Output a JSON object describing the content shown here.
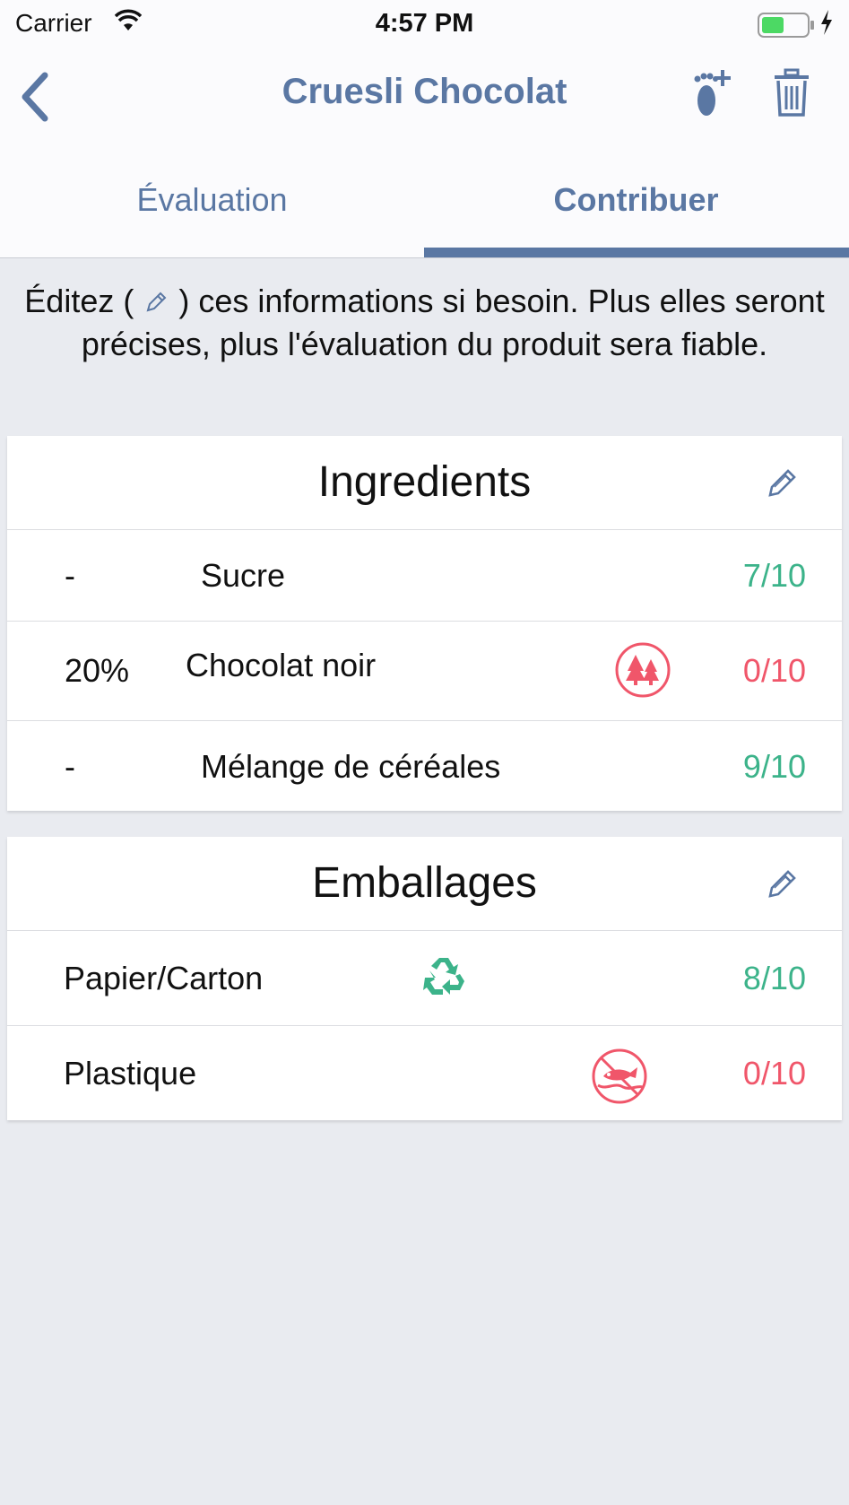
{
  "status_bar": {
    "carrier": "Carrier",
    "time": "4:57 PM"
  },
  "nav": {
    "title": "Cruesli Chocolat",
    "back_icon": "chevron-left-icon",
    "add_footprint_icon": "footprint-add-icon",
    "delete_icon": "trash-icon"
  },
  "tabs": [
    {
      "label": "Évaluation",
      "selected": false
    },
    {
      "label": "Contribuer",
      "selected": true
    }
  ],
  "intro": {
    "before": "Éditez (",
    "after": ") ces informations si besoin. Plus elles seront précises, plus l'évaluation du produit sera fiable."
  },
  "ingredients": {
    "title": "Ingredients",
    "items": [
      {
        "percent": "-",
        "name": "Sucre",
        "score": "7/10",
        "status": "good",
        "icon": null
      },
      {
        "percent": "20%",
        "name": "Chocolat noir",
        "score": "0/10",
        "status": "bad",
        "icon": "deforestation-icon"
      },
      {
        "percent": "-",
        "name": "Mélange de céréales",
        "score": "9/10",
        "status": "good",
        "icon": null
      }
    ]
  },
  "packaging": {
    "title": "Emballages",
    "items": [
      {
        "name": "Papier/Carton",
        "score": "8/10",
        "status": "good",
        "icon": "recycle-icon"
      },
      {
        "name": "Plastique",
        "score": "0/10",
        "status": "bad",
        "icon": "ocean-pollution-icon"
      }
    ]
  },
  "colors": {
    "accent": "#5a77a3",
    "good": "#3cb38a",
    "bad": "#f0566a",
    "background": "#e9ebf0"
  }
}
